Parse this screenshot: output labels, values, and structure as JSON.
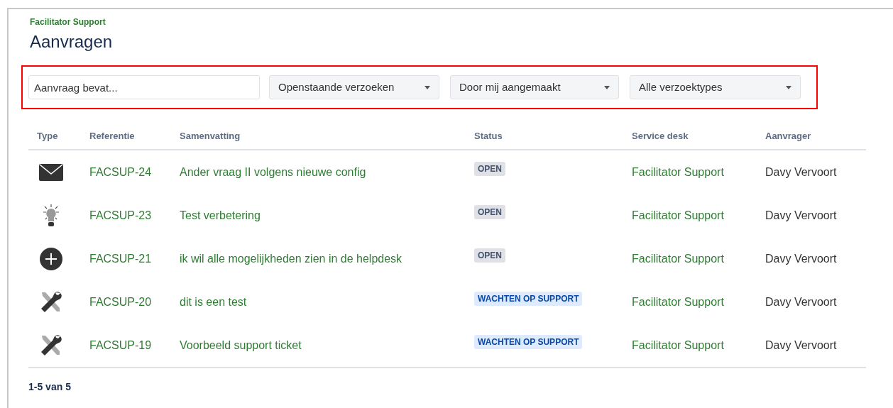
{
  "breadcrumb": "Facilitator Support",
  "title": "Aanvragen",
  "filters": {
    "search": {
      "placeholder": "Aanvraag bevat..."
    },
    "dropdowns": [
      {
        "value": "Openstaande verzoeken"
      },
      {
        "value": "Door mij aangemaakt"
      },
      {
        "value": "Alle verzoektypes"
      }
    ]
  },
  "table": {
    "columns": [
      "Type",
      "Referentie",
      "Samenvatting",
      "Status",
      "Service desk",
      "Aanvrager"
    ],
    "rows": [
      {
        "kind": "email",
        "reference": "FACSUP-24",
        "summary": "Ander vraag II volgens nieuwe config",
        "status": "OPEN",
        "color": "#dfe1e6",
        "service_desk": "Facilitator Support",
        "requester": "Davy Vervoort"
      },
      {
        "kind": "idea",
        "reference": "FACSUP-23",
        "summary": "Test verbetering",
        "status": "OPEN",
        "color": "#dfe1e6",
        "service_desk": "Facilitator Support",
        "requester": "Davy Vervoort"
      },
      {
        "kind": "plus",
        "reference": "FACSUP-21",
        "summary": "ik wil alle mogelijkheden zien in de helpdesk",
        "status": "OPEN",
        "color": "#dfe1e6",
        "service_desk": "Facilitator Support",
        "requester": "Davy Vervoort"
      },
      {
        "kind": "tools",
        "reference": "FACSUP-20",
        "summary": "dit is een test",
        "status": "WACHTEN OP SUPPORT",
        "color": "#deebff",
        "service_desk": "Facilitator Support",
        "requester": "Davy Vervoort"
      },
      {
        "kind": "tools",
        "reference": "FACSUP-19",
        "summary": "Voorbeeld support ticket",
        "status": "WACHTEN OP SUPPORT",
        "color": "#deebff",
        "service_desk": "Facilitator Support",
        "requester": "Davy Vervoort"
      }
    ]
  },
  "pagination": "1-5 van 5"
}
